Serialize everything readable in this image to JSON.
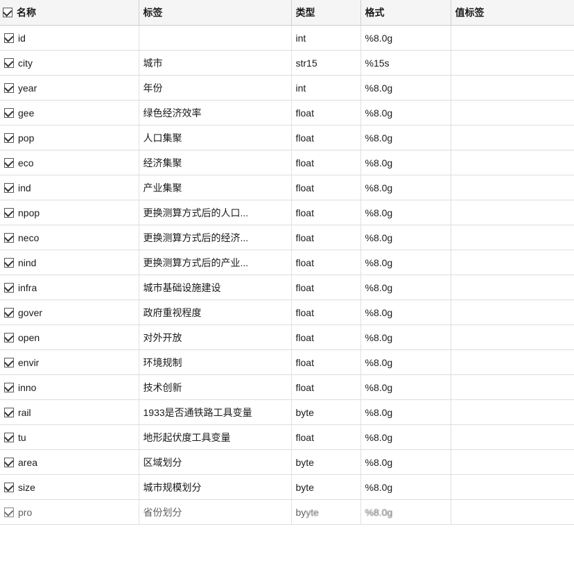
{
  "table": {
    "columns": [
      {
        "key": "name",
        "label": "名称",
        "class": "col-name"
      },
      {
        "key": "tag",
        "label": "标签",
        "class": "col-label"
      },
      {
        "key": "type",
        "label": "类型",
        "class": "col-type"
      },
      {
        "key": "format",
        "label": "格式",
        "class": "col-format"
      },
      {
        "key": "valueLabel",
        "label": "值标签",
        "class": "col-value-label"
      }
    ],
    "rows": [
      {
        "checked": true,
        "name": "id",
        "tag": "",
        "type": "int",
        "format": "%8.0g",
        "valueLabel": ""
      },
      {
        "checked": true,
        "name": "city",
        "tag": "城市",
        "type": "str15",
        "format": "%15s",
        "valueLabel": ""
      },
      {
        "checked": true,
        "name": "year",
        "tag": "年份",
        "type": "int",
        "format": "%8.0g",
        "valueLabel": ""
      },
      {
        "checked": true,
        "name": "gee",
        "tag": "绿色经济效率",
        "type": "float",
        "format": "%8.0g",
        "valueLabel": ""
      },
      {
        "checked": true,
        "name": "pop",
        "tag": "人口集聚",
        "type": "float",
        "format": "%8.0g",
        "valueLabel": ""
      },
      {
        "checked": true,
        "name": "eco",
        "tag": "经济集聚",
        "type": "float",
        "format": "%8.0g",
        "valueLabel": ""
      },
      {
        "checked": true,
        "name": "ind",
        "tag": "产业集聚",
        "type": "float",
        "format": "%8.0g",
        "valueLabel": ""
      },
      {
        "checked": true,
        "name": "npop",
        "tag": "更换测算方式后的人口...",
        "type": "float",
        "format": "%8.0g",
        "valueLabel": ""
      },
      {
        "checked": true,
        "name": "neco",
        "tag": "更换测算方式后的经济...",
        "type": "float",
        "format": "%8.0g",
        "valueLabel": ""
      },
      {
        "checked": true,
        "name": "nind",
        "tag": "更换测算方式后的产业...",
        "type": "float",
        "format": "%8.0g",
        "valueLabel": ""
      },
      {
        "checked": true,
        "name": "infra",
        "tag": "城市基础设施建设",
        "type": "float",
        "format": "%8.0g",
        "valueLabel": ""
      },
      {
        "checked": true,
        "name": "gover",
        "tag": "政府重视程度",
        "type": "float",
        "format": "%8.0g",
        "valueLabel": ""
      },
      {
        "checked": true,
        "name": "open",
        "tag": "对外开放",
        "type": "float",
        "format": "%8.0g",
        "valueLabel": ""
      },
      {
        "checked": true,
        "name": "envir",
        "tag": "环境规制",
        "type": "float",
        "format": "%8.0g",
        "valueLabel": ""
      },
      {
        "checked": true,
        "name": "inno",
        "tag": "技术创新",
        "type": "float",
        "format": "%8.0g",
        "valueLabel": ""
      },
      {
        "checked": true,
        "name": "rail",
        "tag": "1933是否通铁路工具变量",
        "type": "byte",
        "format": "%8.0g",
        "valueLabel": ""
      },
      {
        "checked": true,
        "name": "tu",
        "tag": "地形起伏度工具变量",
        "type": "float",
        "format": "%8.0g",
        "valueLabel": ""
      },
      {
        "checked": true,
        "name": "area",
        "tag": "区域划分",
        "type": "byte",
        "format": "%8.0g",
        "valueLabel": ""
      },
      {
        "checked": true,
        "name": "size",
        "tag": "城市规模划分",
        "type": "byte",
        "format": "%8.0g",
        "valueLabel": ""
      },
      {
        "checked": true,
        "name": "pro",
        "tag": "省份划分",
        "type": "byte",
        "format": "%8.0g",
        "valueLabel": "",
        "partial": true
      }
    ]
  }
}
